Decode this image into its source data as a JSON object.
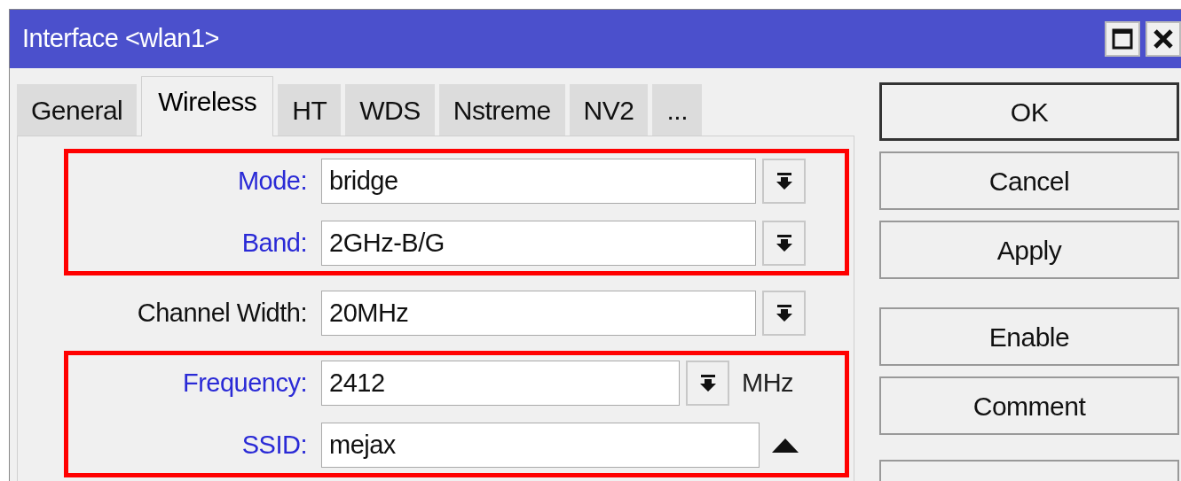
{
  "window": {
    "title": "Interface <wlan1>"
  },
  "title_buttons": [
    {
      "kind": "maximize"
    },
    {
      "kind": "close"
    }
  ],
  "tabs": [
    {
      "label": "General",
      "selected": false
    },
    {
      "label": "Wireless",
      "selected": true
    },
    {
      "label": "HT",
      "selected": false
    },
    {
      "label": "WDS",
      "selected": false
    },
    {
      "label": "Nstreme",
      "selected": false
    },
    {
      "label": "NV2",
      "selected": false
    },
    {
      "label": "...",
      "selected": false
    }
  ],
  "groups": [
    {
      "highlighted": true,
      "fields": [
        {
          "label": "Mode:",
          "emphasized": true,
          "value": "bridge",
          "kind": "dropdown"
        },
        {
          "label": "Band:",
          "emphasized": true,
          "value": "2GHz-B/G",
          "kind": "dropdown"
        }
      ]
    },
    {
      "highlighted": false,
      "fields": [
        {
          "label": "Channel Width:",
          "emphasized": false,
          "value": "20MHz",
          "kind": "dropdown"
        }
      ]
    },
    {
      "highlighted": true,
      "fields": [
        {
          "label": "Frequency:",
          "emphasized": true,
          "value": "2412",
          "kind": "dropdown",
          "unit": "MHz"
        },
        {
          "label": "SSID:",
          "emphasized": true,
          "value": "mejax",
          "kind": "collapse"
        }
      ]
    }
  ],
  "button_groups": [
    [
      {
        "label": "OK",
        "default": true
      },
      {
        "label": "Cancel",
        "default": false
      },
      {
        "label": "Apply",
        "default": false
      }
    ],
    [
      {
        "label": "Enable",
        "default": false
      },
      {
        "label": "Comment",
        "default": false
      },
      {
        "kind": "partial"
      }
    ]
  ]
}
